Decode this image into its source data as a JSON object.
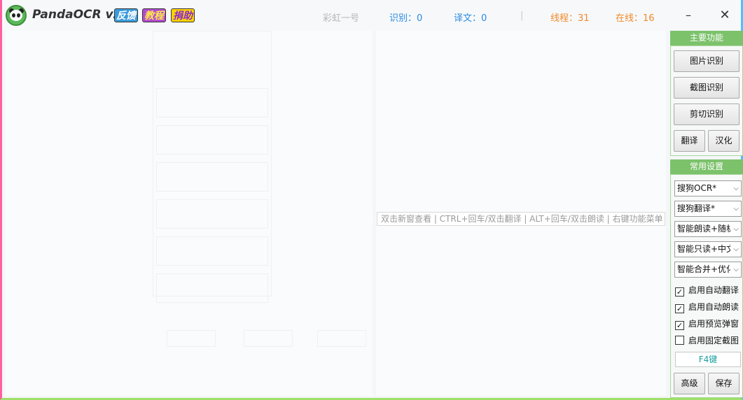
{
  "app": {
    "title": "PandaOCR v2.6",
    "badges": [
      "反馈",
      "教程",
      "捐助"
    ]
  },
  "status": {
    "user": "彩虹一号",
    "recognize": "识别：0",
    "translate": "译文：0",
    "separator": "|",
    "threads": "线程：31",
    "online": "在线：16"
  },
  "window_controls": {
    "minimize": "–",
    "close": "✕"
  },
  "right_pane": {
    "hint": "双击新窗查看 | CTRL+回车/双击翻译 | ALT+回车/双击朗读 | 右键功能菜单"
  },
  "sidebar": {
    "main_group": {
      "title": "主要功能",
      "image_ocr": "图片识别",
      "screenshot_ocr": "截图识别",
      "clipboard_ocr": "剪切识别",
      "translate": "翻译",
      "localize": "汉化"
    },
    "settings_group": {
      "title": "常用设置",
      "ocr_engine": "搜狗OCR*",
      "translate_engine": "搜狗翻译*",
      "read_mode": "智能朗读+随机",
      "read_only_mode": "智能只读+中文",
      "merge_mode": "智能合并+优化",
      "checks": [
        {
          "label": "启用自动翻译",
          "checked": true
        },
        {
          "label": "启用自动朗读",
          "checked": true
        },
        {
          "label": "启用预览弹窗",
          "checked": true
        },
        {
          "label": "启用固定截图",
          "checked": false
        }
      ],
      "hotkey": "F4键",
      "advanced": "高级",
      "save": "保存"
    }
  },
  "colors": {
    "accent_green": "#7cc26b",
    "stat_blue": "#2a8be2",
    "stat_orange": "#f08a2a"
  }
}
